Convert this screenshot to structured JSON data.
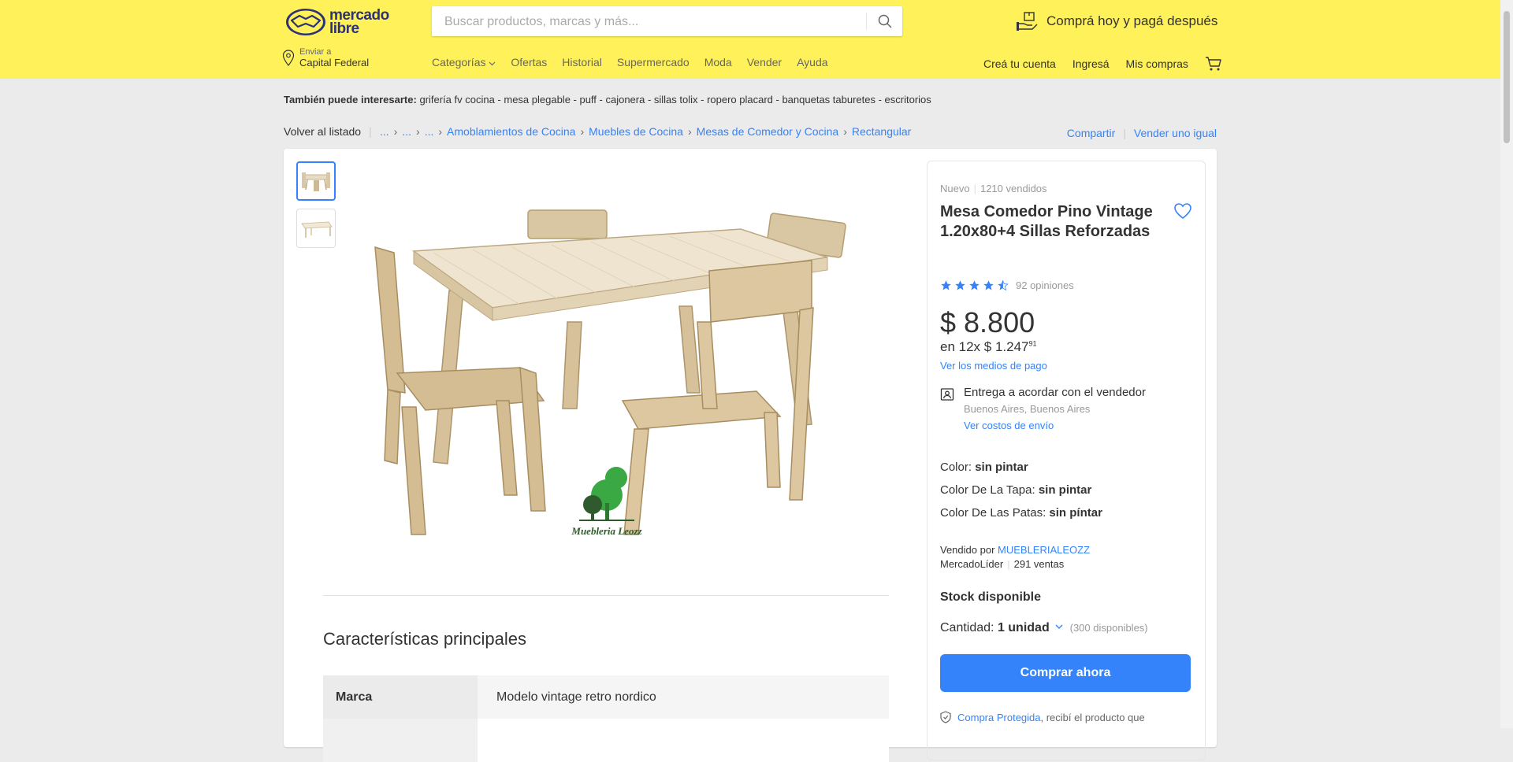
{
  "header": {
    "logo_text_line1": "mercado",
    "logo_text_line2": "libre",
    "search_placeholder": "Buscar productos, marcas y más...",
    "promo_text": "Comprá hoy y pagá después",
    "ship_to_label": "Enviar a",
    "ship_to_location": "Capital Federal",
    "nav": [
      "Categorías",
      "Ofertas",
      "Historial",
      "Supermercado",
      "Moda",
      "Vender",
      "Ayuda"
    ],
    "user_nav": [
      "Creá tu cuenta",
      "Ingresá",
      "Mis compras"
    ],
    "accent_color": "#fff159"
  },
  "interest": {
    "label": "También puede interesarte:",
    "items": "grifería fv cocina - mesa plegable - puff - cajonera - sillas tolix - ropero placard - banquetas taburetes - escritorios"
  },
  "breadcrumb": {
    "back": "Volver al listado",
    "items": [
      "...",
      "...",
      "...",
      "Amoblamientos de Cocina",
      "Muebles de Cocina",
      "Mesas de Comedor y Cocina",
      "Rectangular"
    ],
    "share": "Compartir",
    "sell_same": "Vender uno igual"
  },
  "gallery": {
    "thumbnail_count": 2,
    "watermark": "Muebleria Leozz"
  },
  "features": {
    "title": "Características principales",
    "rows": [
      {
        "key": "Marca",
        "value": "Modelo vintage retro nordico"
      }
    ]
  },
  "product": {
    "condition": "Nuevo",
    "sold": "1210 vendidos",
    "title": "Mesa Comedor Pino Vintage 1.20x80+4 Sillas Reforzadas",
    "rating": 4.5,
    "reviews": "92 opiniones",
    "price": "$ 8.800",
    "installments_prefix": "en 12x $ 1.247",
    "installments_cents": "91",
    "payment_link": "Ver los medios de pago",
    "delivery_title": "Entrega a acordar con el vendedor",
    "delivery_location": "Buenos Aires, Buenos Aires",
    "delivery_link": "Ver costos de envío",
    "attrs": [
      {
        "label": "Color: ",
        "value": "sin pintar"
      },
      {
        "label": "Color De La Tapa: ",
        "value": "sin pintar"
      },
      {
        "label": "Color De Las Patas: ",
        "value": "sin píntar"
      }
    ],
    "seller_prefix": "Vendido por ",
    "seller_name": "MUEBLERIALEOZZ",
    "seller_badge": "MercadoLíder",
    "seller_sales": "291 ventas",
    "stock": "Stock disponible",
    "qty_label": "Cantidad: ",
    "qty_value": "1 unidad",
    "qty_available": "(300 disponibles)",
    "buy_button": "Comprar ahora",
    "protected_link": "Compra Protegida",
    "protected_text": ", recibí el producto que",
    "button_color": "#3483fa"
  }
}
